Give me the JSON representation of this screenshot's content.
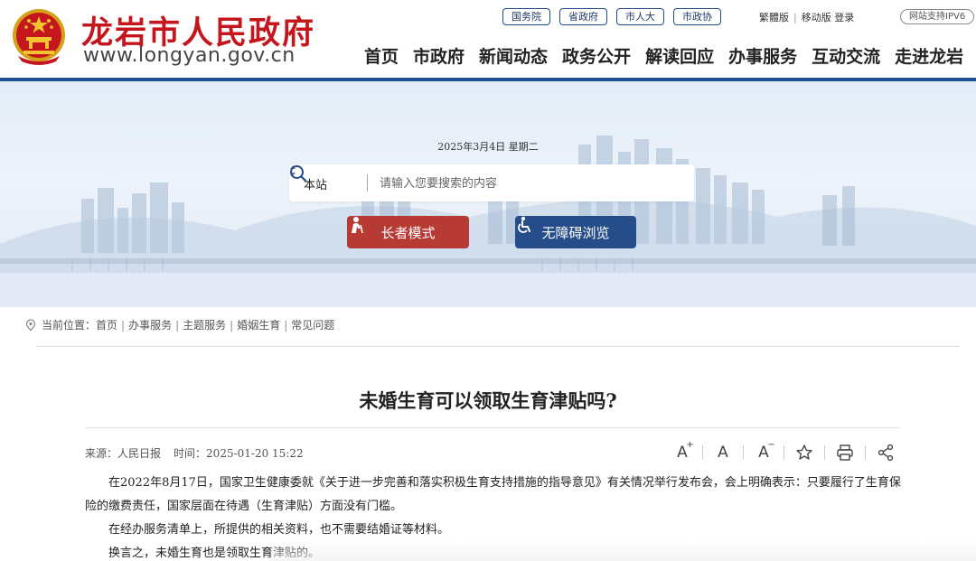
{
  "header": {
    "title": "龙岩市人民政府",
    "url_text": "www.longyan.gov.cn",
    "top_links": [
      "国务院",
      "省政府",
      "市人大",
      "市政协"
    ],
    "traditional": "繁體版",
    "mobile": "移动版",
    "login": "登录",
    "ipv6": "网站支持IPV6",
    "nav": [
      "首页",
      "市政府",
      "新闻动态",
      "政务公开",
      "解读回应",
      "办事服务",
      "互动交流",
      "走进龙岩"
    ],
    "accent_color": "#c4161c",
    "nav_line_color": "#1e4e8c"
  },
  "banner": {
    "date": "2025年3月4日 星期二",
    "search": {
      "scope": "本站",
      "placeholder": "请输入您要搜索的内容"
    },
    "elder_mode": "长者模式",
    "accessible": "无障碍浏览"
  },
  "breadcrumb": {
    "label": "当前位置：",
    "items": [
      "首页",
      "办事服务",
      "主题服务",
      "婚姻生育",
      "常见问题"
    ]
  },
  "article": {
    "title": "未婚生育可以领取生育津贴吗?",
    "source_label": "来源：",
    "source": "人民日报",
    "time_label": "时间：",
    "time": "2025-01-20 15:22",
    "paragraphs": [
      "在2022年8月17日，国家卫生健康委就《关于进一步完善和落实积极生育支持措施的指导意见》有关情况举行发布会，会上明确表示：只要履行了生育保险的缴费责任，国家层面在待遇（生育津贴）方面没有门槛。",
      "在经办服务清单上，所提供的相关资料，也不需要结婚证等材料。",
      "换言之，未婚生育也是领取生育津贴的。"
    ],
    "tools": {
      "font_large": "A",
      "font_normal": "A",
      "font_small": "A"
    }
  }
}
